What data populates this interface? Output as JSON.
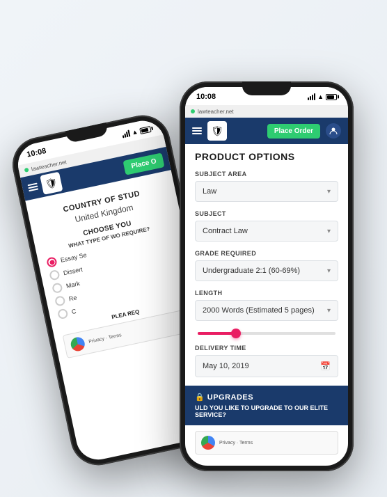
{
  "back_phone": {
    "status": {
      "time": "10:08",
      "url": "lawteacher.net"
    },
    "nav": {
      "place_order": "Place O"
    },
    "page": {
      "title": "COUNTRY OF STUD",
      "country": "United Kingdom",
      "section_title": "CHOOSE YOU",
      "question": "WHAT TYPE OF WO REQUIRE?",
      "options": [
        {
          "label": "Essay Se",
          "selected": true
        },
        {
          "label": "Dissert",
          "selected": false
        },
        {
          "label": "Mark",
          "selected": false
        },
        {
          "label": "Re",
          "selected": false
        },
        {
          "label": "C",
          "selected": false
        }
      ],
      "please_label": "PLEA REQ"
    }
  },
  "front_phone": {
    "status": {
      "time": "10:08",
      "url": "lawteacher.net"
    },
    "nav": {
      "place_order": "Place Order",
      "user_icon": "👤"
    },
    "page": {
      "title": "PRODUCT OPTIONS",
      "subject_area_label": "SUBJECT AREA",
      "subject_area_value": "Law",
      "subject_label": "SUBJECT",
      "subject_value": "Contract Law",
      "grade_label": "GRADE REQUIRED",
      "grade_value": "Undergraduate 2:1 (60-69%)",
      "length_label": "LENGTH",
      "length_value": "2000 Words (Estimated 5 pages)",
      "delivery_label": "DELIVERY TIME",
      "delivery_value": "May 10, 2019",
      "upgrades_title": "UPGRADES",
      "upgrades_question": "ULD YOU LIKE TO UPGRADE TO OUR ELITE SERVICE?"
    }
  }
}
